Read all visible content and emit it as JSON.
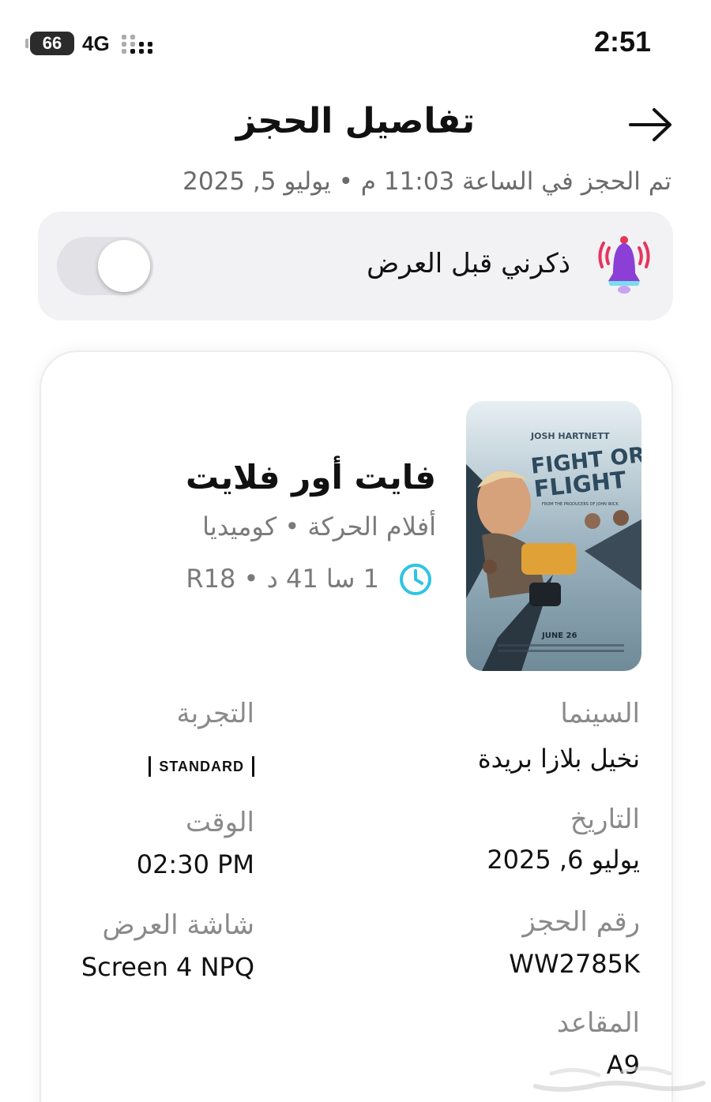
{
  "status_bar": {
    "battery": "66",
    "network": "4G",
    "time": "2:51"
  },
  "header": {
    "title": "تفاصيل الحجز",
    "back_icon": "arrow-right-icon",
    "booked_at": "تم الحجز في الساعة 11:03 م • يوليو 5, 2025"
  },
  "reminder": {
    "label": "ذكرني قبل العرض",
    "icon": "bell-ringing-icon",
    "enabled": false
  },
  "movie": {
    "title": "فايت أور فلايت",
    "genres": "أفلام الحركة • كوميديا",
    "runtime_rating": "1 سا 41 د • R18",
    "poster": {
      "actor": "JOSH HARTNETT",
      "title_line1": "FIGHT OR",
      "title_line2": "FLIGHT",
      "tagline": "FROM THE PRODUCERS OF JOHN WICK",
      "release": "JUNE 26"
    }
  },
  "details": {
    "cinema_label": "السينما",
    "cinema_value": "نخيل بلازا بريدة",
    "experience_label": "التجربة",
    "experience_value": "STANDARD",
    "date_label": "التاريخ",
    "date_value": "يوليو 6, 2025",
    "time_label": "الوقت",
    "time_value": "02:30 PM",
    "booking_label": "رقم الحجز",
    "booking_value": "WW2785K",
    "screen_label": "شاشة العرض",
    "screen_value": "Screen 4 NPQ",
    "seats_label": "المقاعد",
    "seats_value": "A9"
  },
  "colors": {
    "accent_cyan": "#2ec4e6",
    "bell_purple": "#8b3fd6",
    "bell_red": "#e8335b",
    "muted_text": "#7a7a7a"
  }
}
